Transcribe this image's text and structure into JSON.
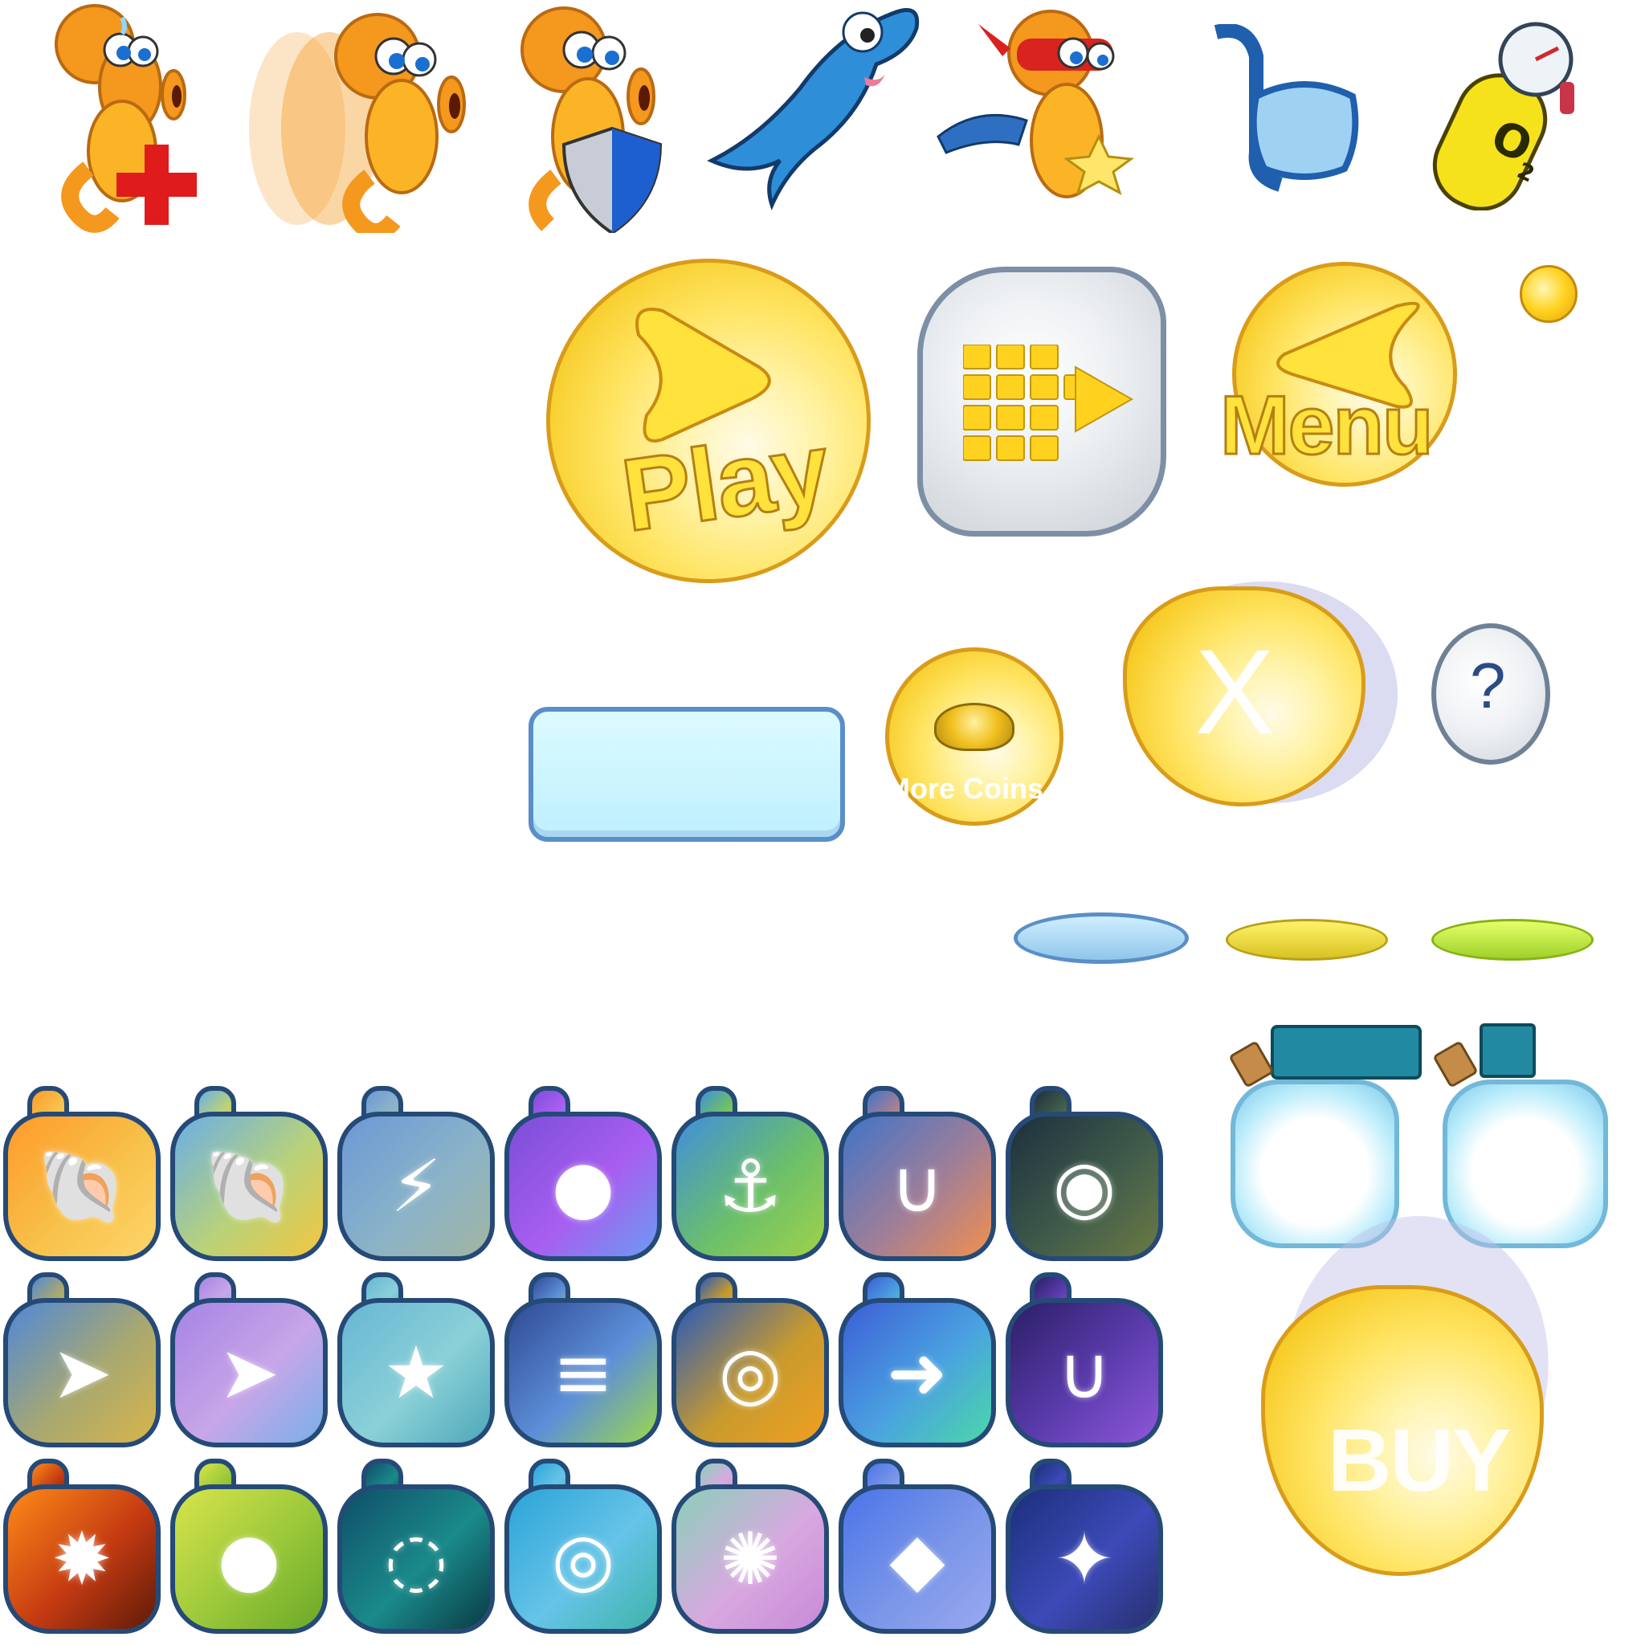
{
  "buttons": {
    "play_label": "Play",
    "menu_label": "Menu",
    "more_coins_label": "More Coins",
    "close_label": "X",
    "help_label": "?",
    "buy_label": "BUY"
  },
  "tank_label": "O",
  "tank_subscript": "2",
  "colors": {
    "seahorse_orange": "#f4981e",
    "button_yellow": "#ffe462",
    "button_silver": "#dfe3e8",
    "tile_outline": "#254a77",
    "field_blue": "#cdf7ff"
  },
  "top_icons": [
    "seahorse-health-icon",
    "seahorse-speed-icon",
    "seahorse-shield-icon",
    "dolphin-icon",
    "seahorse-hero-icon",
    "snorkel-mask-icon",
    "oxygen-tank-icon"
  ],
  "tiles": [
    {
      "name": "tile-clam-icon",
      "glyph": "🐚",
      "bg": "linear-gradient(135deg,#ff9a2a,#f7c14a 55%,#ffd56a)"
    },
    {
      "name": "tile-clams-group-icon",
      "glyph": "🐚",
      "bg": "linear-gradient(135deg,#6aaee8,#b8d27a 55%,#f3c640)"
    },
    {
      "name": "tile-lightning-icon",
      "glyph": "⚡",
      "bg": "linear-gradient(135deg,#6c98d6,#8ab3c8 55%,#a2b4a2)"
    },
    {
      "name": "tile-bubble-icon",
      "glyph": "●",
      "bg": "linear-gradient(135deg,#7b4ed8,#a85ef0 55%,#6b9bf2)"
    },
    {
      "name": "tile-anchor-icon",
      "glyph": "⚓",
      "bg": "linear-gradient(135deg,#3f8fdc,#6cbf6a 55%,#9fd24a)"
    },
    {
      "name": "tile-magnet-icon",
      "glyph": "∪",
      "bg": "linear-gradient(135deg,#3f74c8,#a07e98 55%,#f18f4e)"
    },
    {
      "name": "tile-diving-helmet-icon",
      "glyph": "◉",
      "bg": "linear-gradient(135deg,#1d2f3e,#3f5b4a 55%,#6b7a44)"
    },
    {
      "name": "tile-green-fish-icon",
      "glyph": "➤",
      "bg": "linear-gradient(135deg,#4f88d8,#a9a870 55%,#d7b54a)"
    },
    {
      "name": "tile-red-fish-icon",
      "glyph": "➤",
      "bg": "linear-gradient(135deg,#a684e4,#c8a6e8 55%,#78b0e8)"
    },
    {
      "name": "tile-starfish-icon",
      "glyph": "★",
      "bg": "linear-gradient(135deg,#67b6d4,#8bd0d8 55%,#4da8b8)"
    },
    {
      "name": "tile-speed-streaks-icon",
      "glyph": "≡",
      "bg": "linear-gradient(135deg,#2f4a94,#5d8fd8 55%,#9bd84a)"
    },
    {
      "name": "tile-spiral-icon",
      "glyph": "◎",
      "bg": "linear-gradient(135deg,#2a5ab8,#c89a2e 55%,#f0a020)"
    },
    {
      "name": "tile-dash-seahorse-icon",
      "glyph": "➜",
      "bg": "linear-gradient(135deg,#3c5ed6,#4aa2e0 55%,#4bd8a8)"
    },
    {
      "name": "tile-magnet-electric-icon",
      "glyph": "∪",
      "bg": "linear-gradient(135deg,#2b1f66,#5c3cae 55%,#8f57d8)"
    },
    {
      "name": "tile-explosion-icon",
      "glyph": "✹",
      "bg": "linear-gradient(135deg,#ff8a18,#c43a12 55%,#5e1b08)"
    },
    {
      "name": "tile-sea-mine-icon",
      "glyph": "●",
      "bg": "linear-gradient(135deg,#d8e44a,#9ac83a 55%,#6ba828)"
    },
    {
      "name": "tile-vortex-ring-icon",
      "glyph": "◌",
      "bg": "linear-gradient(135deg,#0f4e68,#1a8a8a 55%,#0a3a44)"
    },
    {
      "name": "tile-sonar-icon",
      "glyph": "◎",
      "bg": "linear-gradient(135deg,#2aa3d8,#66c4e8 55%,#3eb3a8)"
    },
    {
      "name": "tile-puffer-icon",
      "glyph": "✺",
      "bg": "linear-gradient(135deg,#8ad0b8,#d8a8e0 55%,#c88ad8)"
    },
    {
      "name": "tile-diamond-icon",
      "glyph": "◆",
      "bg": "linear-gradient(135deg,#4a74e8,#7a96e8 55%,#9aa8f0)"
    },
    {
      "name": "tile-seahorse-bubble-icon",
      "glyph": "✦",
      "bg": "linear-gradient(135deg,#1a2f7a,#3d4ab8 55%,#273070)"
    }
  ]
}
